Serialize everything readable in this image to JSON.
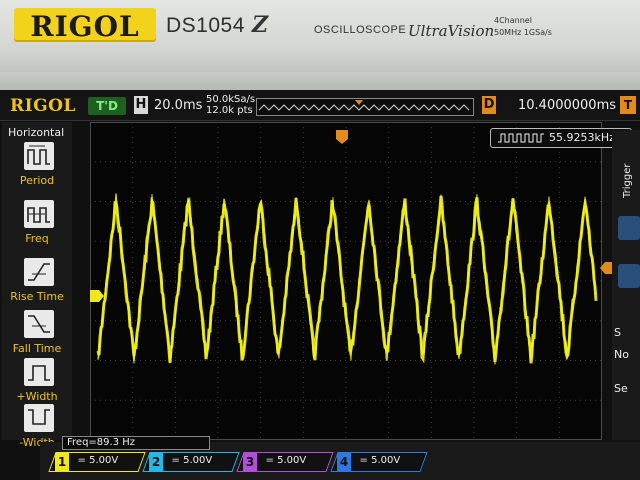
{
  "device": {
    "brand": "RIGOL",
    "model": "DS1054",
    "model_mark": "Z",
    "type_word": "OSCILLOSCOPE",
    "series_name": "UltraVision",
    "spec_channels": "4Channel",
    "spec_bandwidth": "50MHz 1GSa/s"
  },
  "screen": {
    "brand": "RIGOL",
    "trigger_status": "T'D",
    "h_label": "H",
    "timebase": "20.0ms",
    "sample_rate": "50.0kSa/s",
    "memory_points": "12.0k pts",
    "d_label": "D",
    "delay": "10.4000000ms",
    "t_label": "T",
    "measured_freq": "55.9253kHz",
    "trigger_label": "Trigger",
    "freq_counter": "Freq=89.3 Hz"
  },
  "menu": {
    "title": "Horizontal",
    "items": [
      {
        "label": "Period"
      },
      {
        "label": "Freq"
      },
      {
        "label": "Rise Time"
      },
      {
        "label": "Fall Time"
      },
      {
        "label": "+Width"
      },
      {
        "label": "-Width"
      }
    ]
  },
  "right_menu": {
    "soft_labels": [
      "S",
      "No",
      "Se"
    ]
  },
  "channels": [
    {
      "num": "1",
      "scale": "5.00V",
      "color": "#f0e81a",
      "text_color": "#111"
    },
    {
      "num": "2",
      "scale": "5.00V",
      "color": "#25b7e6",
      "text_color": "#111"
    },
    {
      "num": "3",
      "scale": "5.00V",
      "color": "#b34fd6",
      "text_color": "#111"
    },
    {
      "num": "4",
      "scale": "5.00V",
      "color": "#2f78e0",
      "text_color": "#111"
    }
  ],
  "colors": {
    "trace": "#f2f21c",
    "accent_orange": "#e28a1a",
    "brand_yellow": "#f2d21a"
  },
  "waveform": {
    "shape": "triangle",
    "peaks_visible": 14
  }
}
